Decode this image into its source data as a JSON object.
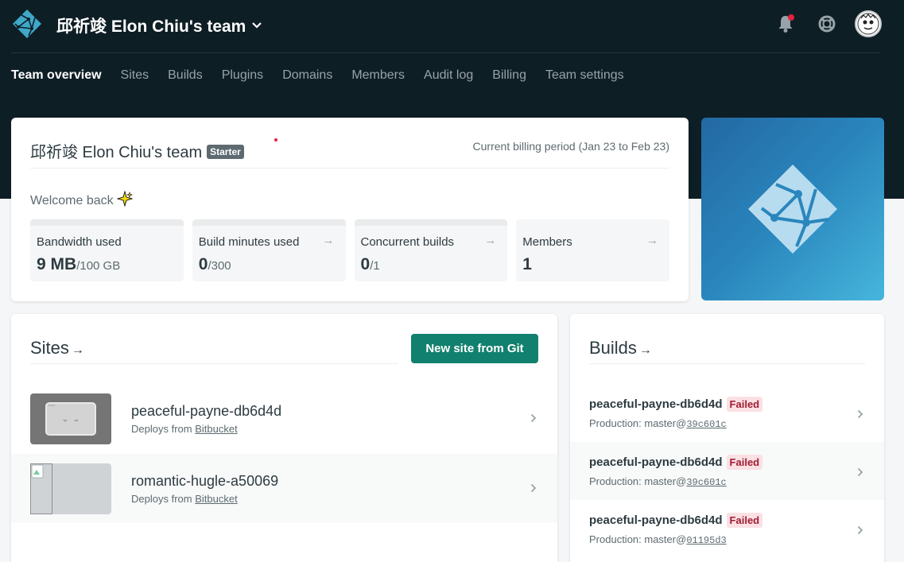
{
  "header": {
    "team_name": "邱祈竣 Elon Chiu's team"
  },
  "nav": {
    "items": [
      "Team overview",
      "Sites",
      "Builds",
      "Plugins",
      "Domains",
      "Members",
      "Audit log",
      "Billing",
      "Team settings"
    ],
    "active": "Team overview"
  },
  "team_card": {
    "title": "邱祈竣 Elon Chiu's team",
    "plan_badge": "Starter",
    "billing_period": "Current billing period (Jan 23 to Feb 23)",
    "welcome": "Welcome back",
    "stats": [
      {
        "label": "Bandwidth used",
        "value": "9 MB",
        "limit": "/100 GB",
        "arrow": ""
      },
      {
        "label": "Build minutes used",
        "value": "0",
        "limit": "/300",
        "arrow": "→"
      },
      {
        "label": "Concurrent builds",
        "value": "0",
        "limit": "/1",
        "arrow": "→"
      },
      {
        "label": "Members",
        "value": "1",
        "limit": "",
        "arrow": "→"
      }
    ]
  },
  "sites": {
    "title": "Sites",
    "arrow": "→",
    "new_button": "New site from Git",
    "items": [
      {
        "name": "peaceful-payne-db6d4d",
        "deploy_prefix": "Deploys from ",
        "provider": "Bitbucket"
      },
      {
        "name": "romantic-hugle-a50069",
        "deploy_prefix": "Deploys from ",
        "provider": "Bitbucket"
      }
    ]
  },
  "builds": {
    "title": "Builds",
    "arrow": "→",
    "items": [
      {
        "name": "peaceful-payne-db6d4d",
        "status": "Failed",
        "context": "Production: ",
        "ref": "master@",
        "sha": "39c601c"
      },
      {
        "name": "peaceful-payne-db6d4d",
        "status": "Failed",
        "context": "Production: ",
        "ref": "master@",
        "sha": "39c601c"
      },
      {
        "name": "peaceful-payne-db6d4d",
        "status": "Failed",
        "context": "Production: ",
        "ref": "master@",
        "sha": "01195d3"
      }
    ]
  },
  "colors": {
    "header_bg": "#0e1e25",
    "primary_button": "#12806e",
    "failed_bg": "#fbe0e4",
    "failed_text": "#a01d35",
    "notification_dot": "#e5213b"
  }
}
